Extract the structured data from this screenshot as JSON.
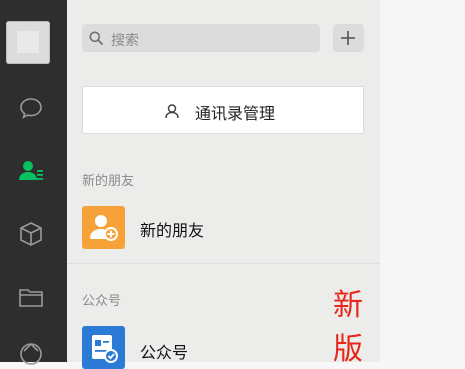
{
  "search": {
    "placeholder_text": "搜索"
  },
  "manage_contacts": {
    "label": "通讯录管理"
  },
  "sections": [
    {
      "title": "新的朋友",
      "item_label": "新的朋友"
    },
    {
      "title": "公众号",
      "item_label": "公众号"
    }
  ],
  "annotation": {
    "text": "新版"
  },
  "colors": {
    "sidebar_bg": "#2e2e2e",
    "active_green": "#07c160",
    "new_friend_orange": "#f7a238",
    "official_account_blue": "#2a7ad6",
    "annotation_red": "#e7271b"
  },
  "icons": {
    "sidebar": [
      "chat-icon",
      "contacts-icon",
      "favorites-icon",
      "files-icon",
      "moments-icon"
    ],
    "search": "search-icon",
    "add": "plus-icon",
    "manage": "contacts-manage-icon"
  }
}
